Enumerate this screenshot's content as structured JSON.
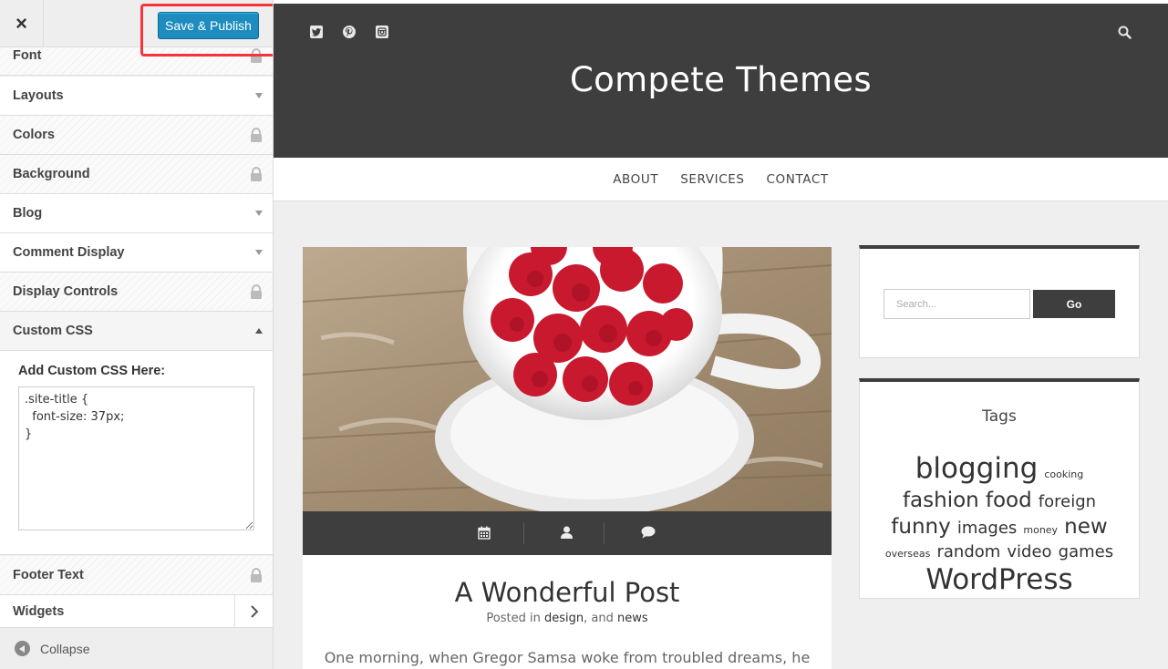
{
  "sidebar": {
    "close_glyph": "×",
    "publish_label": "Save & Publish",
    "items": [
      {
        "label": "Font",
        "indicator": "lock"
      },
      {
        "label": "Layouts",
        "indicator": "arrow-down"
      },
      {
        "label": "Colors",
        "indicator": "lock"
      },
      {
        "label": "Background",
        "indicator": "lock"
      },
      {
        "label": "Blog",
        "indicator": "arrow-down"
      },
      {
        "label": "Comment Display",
        "indicator": "arrow-down"
      },
      {
        "label": "Display Controls",
        "indicator": "lock"
      },
      {
        "label": "Custom CSS",
        "indicator": "arrow-up"
      },
      {
        "label": "Footer Text",
        "indicator": "lock"
      },
      {
        "label": "Widgets",
        "indicator": "chevron-right"
      }
    ],
    "custom_css": {
      "label": "Add Custom CSS Here:",
      "value": ".site-title {\n  font-size: 37px;\n}"
    },
    "collapse_label": "Collapse"
  },
  "preview": {
    "social_icons": [
      "twitter-icon",
      "pinterest-icon",
      "instagram-icon"
    ],
    "site_title": "Compete Themes",
    "menu": [
      "ABOUT",
      "SERVICES",
      "CONTACT"
    ],
    "post": {
      "image_description": "white cup filled with raspberries on a wooden table",
      "meta_icons": [
        "calendar-icon",
        "user-icon",
        "comment-icon"
      ],
      "title": "A Wonderful Post",
      "byline_prefix": "Posted in",
      "category_1": "design",
      "byline_joiner": ", and",
      "category_2": "news",
      "excerpt": "One morning, when Gregor Samsa woke from troubled dreams, he"
    },
    "search_widget": {
      "placeholder": "Search...",
      "button_label": "Go"
    },
    "tags_widget": {
      "title": "Tags",
      "tags": [
        {
          "name": "blogging",
          "size": "xl"
        },
        {
          "name": "cooking",
          "size": "xs"
        },
        {
          "name": "fashion",
          "size": "l"
        },
        {
          "name": "food",
          "size": "l"
        },
        {
          "name": "foreign",
          "size": "m"
        },
        {
          "name": "funny",
          "size": "l"
        },
        {
          "name": "images",
          "size": "m"
        },
        {
          "name": "money",
          "size": "xs"
        },
        {
          "name": "new",
          "size": "l"
        },
        {
          "name": "overseas",
          "size": "xs"
        },
        {
          "name": "random",
          "size": "m"
        },
        {
          "name": "video",
          "size": "m"
        },
        {
          "name": "games",
          "size": "m"
        },
        {
          "name": "WordPress",
          "size": "xl"
        }
      ]
    }
  },
  "colors": {
    "publish_button": "#1e8cbe",
    "highlight": "#f4353d",
    "header_dark": "#3e3e3e",
    "preview_bg": "#efefef"
  }
}
